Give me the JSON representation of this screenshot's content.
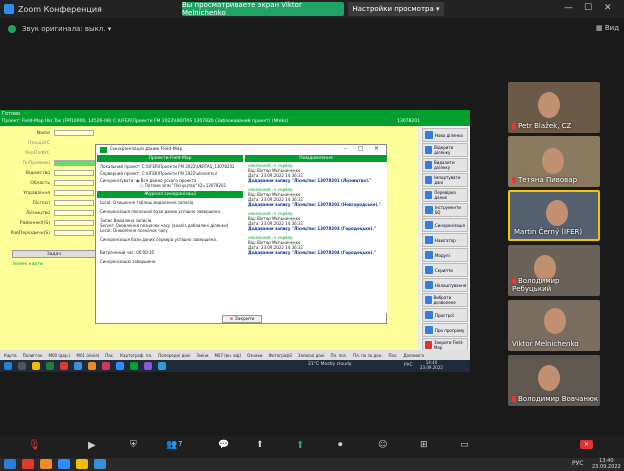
{
  "zoom": {
    "app_title": "Zoom Конференция",
    "share_banner": "Вы просматриваете экран Viktor Melnichenko",
    "view_options": "Настройки просмотра",
    "audio_select": "Звук оригинала: выкл.",
    "view_label": "Вид",
    "participant_count": "7"
  },
  "remote": {
    "window_title": "Готово",
    "project_line": "Проект: Field-Map Ukr,Tas (FM10000, 14526-08) C:\\UFER\\Проекти FM 2022\\UKRTAS 1307820 (Заблокований проект)   (Nteks)",
    "project_id": "13078201",
    "form_labels": [
      "Name",
      "ПлощаУС",
      "ОкрПлФУС",
      "ПлПрийомн",
      "Відомство",
      "Область",
      "Управління",
      "Лісгосп",
      "Лісництво",
      "РайоннікУ(S)",
      "РайПеріодичн(S)"
    ],
    "side_buttons": [
      "Нова ділянка",
      "Відкрити ділянку",
      "Видалити ділянку",
      "Імпортувати дані",
      "Перевірка даних",
      "Інструменти SQ",
      "Синхронізація",
      "Навігатор",
      "Модулі",
      "Скрипти",
      "Налаштування",
      "Вибрати дозволене",
      "Пристрої",
      "Про програму",
      "Закрити Field-Map"
    ],
    "zapysat_button": "Задач",
    "zelen_link": "Зелені карти",
    "bottom_tabs": [
      "Карта",
      "Полиггон",
      "M00 (дер.)",
      "M01 (лінія)",
      "Пас.",
      "Картограф. пл.",
      "Попередні дані",
      "Зміни",
      "M07 (вн. від)",
      "Ознаки",
      "Фотографії",
      "Записи/ дані",
      "Пл. поз.",
      "Пл. по за дон.",
      "Поз.",
      "Допомога"
    ],
    "sys_temp": "21°C",
    "sys_weather": "Mostly cloudy",
    "sys_lang": "РУС",
    "sys_time": "14:40",
    "sys_date": "23.09.2022"
  },
  "dialog": {
    "title": "Синхронізація даних Field-Map",
    "left_header": "Проекти Field-Map",
    "local_project_label": "Локальний проект:",
    "local_project_value": "C:\\UFER\\Проекти FM 2022\\UKRTAS_13078202",
    "server_project_label": "Серверний проект:",
    "server_project_value": "C:\\UFER\\Проекти FM 2022\\ukrsermul",
    "sync_label": "Синхронізувати:",
    "radio_1": "Вся дамно усього проекта",
    "radio_2": "Потоми зіпм \"Ліснуцтва\" ID=13078201",
    "journal_header": "Журнал синхронізації",
    "journal_lines": [
      "Local: Очищення таблиці видалення записів",
      "Синхронізація локальної бази даних успішно завершена.",
      "Запис Видалена записів",
      "Server: Оновлення позначок часу (аналіз добавлені ділянки)",
      "Local: Оновлення позначок часу",
      "Синхронізація бази даних сервера успішно завершена.",
      "Витрачений час: 00:00:35",
      "Синхронізацію завершено."
    ],
    "right_header": "Повідомлення",
    "messages": [
      {
        "route": "локальний -> сервер",
        "label": "Від:",
        "from": "Віктор Мельниченко",
        "date_label": "Дата:",
        "date": "23.09.2022 14:36:31",
        "text": "Додавання запису \"Ліснцтво: 13078201 (Лісництво).\""
      },
      {
        "route": "локальний -> сервер",
        "label": "Від:",
        "from": "Віктор Мельниченко",
        "date_label": "Дата:",
        "date": "23.09.2022 14:36:31",
        "text": "Додавання запису \"Ліснцтво: 13078202 (Новгородське).\""
      },
      {
        "route": "локальний -> сервер",
        "label": "Від:",
        "from": "Віктор Мельниченко",
        "date_label": "Дата:",
        "date": "23.09.2022 14:36:31",
        "text": "Додавання запису \"Ліснцтво: 13078203 (Городецьке).\""
      },
      {
        "route": "локальний -> сервер",
        "label": "Від:",
        "from": "Віктор Мельниченко",
        "date_label": "Дата:",
        "date": "23.09.2022 14:36:31",
        "text": "Додавання запису \"Ліснцтво: 13078204 (Городецьке).\""
      }
    ],
    "close_button": "Закрити"
  },
  "participants": [
    {
      "name": "Petr Blažek, CZ",
      "muted": true
    },
    {
      "name": "Тетяна Пивовар",
      "muted": true
    },
    {
      "name": "Martin Černý (IFER)",
      "muted": false,
      "active": true
    },
    {
      "name": "Володимир Ребуцький",
      "muted": true
    },
    {
      "name": "Viktor Melnichenko",
      "muted": false
    },
    {
      "name": "Володимир Вовчанюк",
      "muted": true
    }
  ],
  "taskbar": {
    "time": "13:40",
    "date": "23.09.2022",
    "lang": "РУС"
  }
}
